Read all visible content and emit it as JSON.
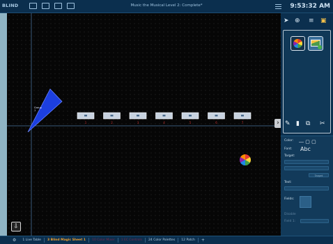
{
  "topbar": {
    "mode": "BLIND",
    "title": "Music the Musical Level 2: Complete*",
    "clock": "9:53:32 AM"
  },
  "icons": {
    "monitor": "monitor-icon",
    "layout": "layout-icon",
    "window": "window-icon",
    "grid": "grid-icon",
    "pointer": "pointer-icon",
    "zoom": "zoom-icon",
    "list": "list-icon",
    "copy": "copy-icon",
    "pencil": "pencil-icon",
    "brush": "brush-icon",
    "stamp": "stamp-icon",
    "scissors": "scissors-icon"
  },
  "canvas": {
    "selection_label": "Group\n1",
    "fixture_channels": [
      "1",
      "2",
      "3",
      "4",
      "5",
      "6",
      "7"
    ],
    "arrow": "›",
    "home": "⇩"
  },
  "properties": {
    "color_label": "Color:",
    "font_label": "Font:",
    "font_sample": "Abc",
    "target_label": "Target:",
    "target_button": "Target",
    "text_label": "Text:",
    "fields_label": "Fields:",
    "disable_label": "Disable",
    "field_label": "Field 1:"
  },
  "tabs": [
    {
      "label": "1 Live Table",
      "state": "normal"
    },
    {
      "label": "3 Blind Magic Sheet 1",
      "state": "active"
    },
    {
      "label": "10 Color Mixer",
      "state": "dim"
    },
    {
      "label": "1 EC Controls",
      "state": "dim"
    },
    {
      "label": "24 Color Palettes",
      "state": "normal"
    },
    {
      "label": "12 Patch",
      "state": "normal"
    }
  ],
  "tab_add": "+",
  "colors": {
    "chrome": "#0b2f4e",
    "active_tab": "#f0a030",
    "selection": "#1c3fe0",
    "fixture": "#c8d3e0"
  }
}
